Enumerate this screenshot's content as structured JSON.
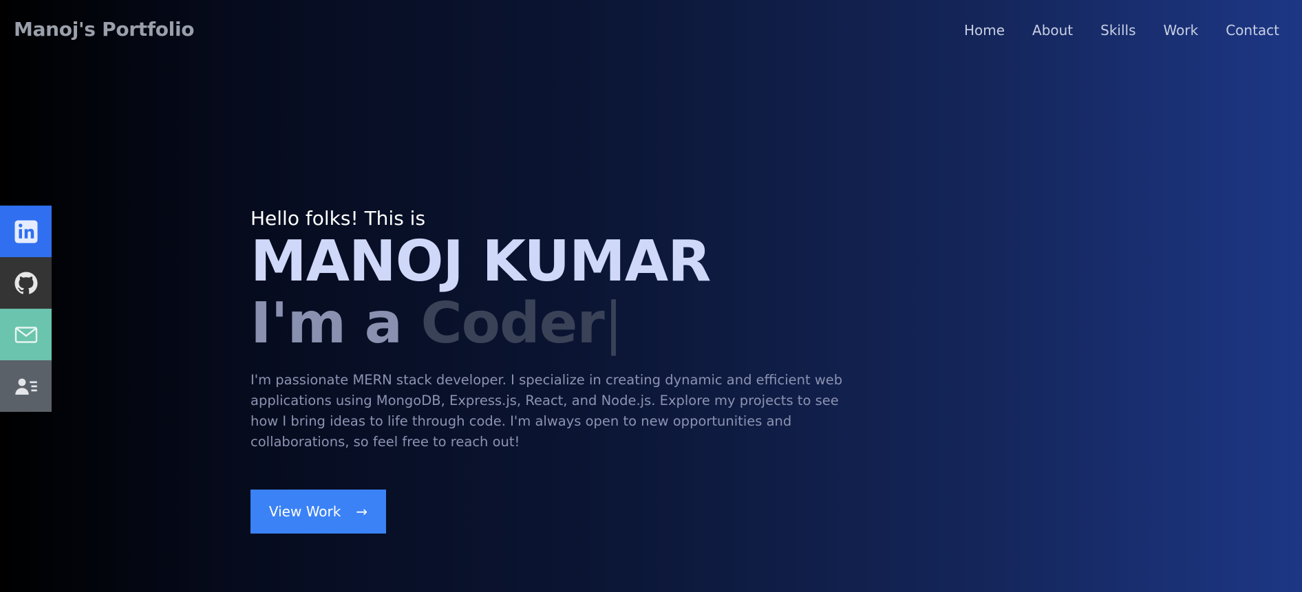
{
  "header": {
    "brand": "Manoj's Portfolio",
    "nav": [
      "Home",
      "About",
      "Skills",
      "Work",
      "Contact"
    ]
  },
  "social": [
    {
      "icon": "linkedin-icon",
      "color": "#2f6ff0"
    },
    {
      "icon": "github-icon",
      "color": "#343434"
    },
    {
      "icon": "mail-icon",
      "color": "#6bc4ad"
    },
    {
      "icon": "contact-card-icon",
      "color": "#5b6168"
    }
  ],
  "hero": {
    "greeting": "Hello folks! This is",
    "name": "MANOJ KUMAR",
    "role_prefix": "I'm a ",
    "role_word": "Coder",
    "cursor": "|",
    "description": "I'm passionate MERN stack developer. I specialize in creating dynamic and efficient web applications using MongoDB, Express.js, React, and Node.js. Explore my projects to see how I bring ideas to life through code. I'm always open to new opportunities and collaborations, so feel free to reach out!",
    "cta_label": "View Work",
    "cta_arrow": "→"
  },
  "colors": {
    "accent": "#3b82f6",
    "name": "#d0d8fa"
  }
}
